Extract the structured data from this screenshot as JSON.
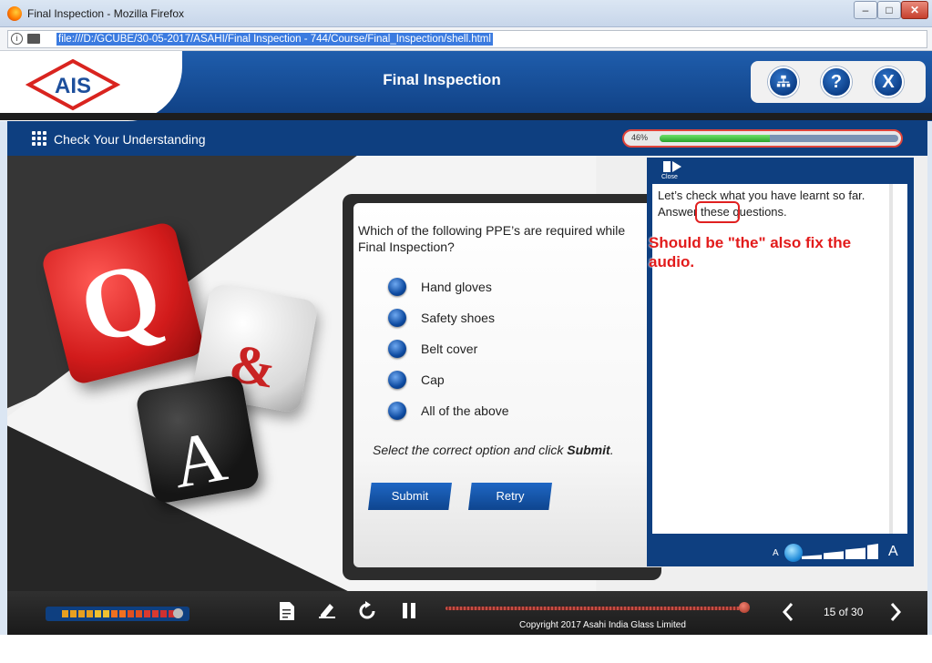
{
  "browser": {
    "window_title": "Final Inspection - Mozilla Firefox",
    "url": "file:///D:/GCUBE/30-05-2017/ASAHI/Final Inspection - 744/Course/Final_Inspection/shell.html",
    "window_buttons": {
      "minimize": "‒",
      "maximize": "□",
      "close": "✕"
    }
  },
  "header": {
    "logo_text": "AIS",
    "course_title": "Final Inspection",
    "buttons": {
      "sitemap": "sitemap-icon",
      "help_label": "?",
      "exit_label": "X"
    }
  },
  "subheader": {
    "section_title": "Check Your Understanding",
    "progress": {
      "percent_label": "46%",
      "value": 0.46
    }
  },
  "question": {
    "text": "Which of the following PPE’s are required while Final Inspection?",
    "options": [
      "Hand gloves",
      "Safety shoes",
      "Belt cover",
      "Cap",
      "All of the above"
    ],
    "instruction_prefix": "Select the correct option and click ",
    "instruction_action": "Submit",
    "instruction_suffix": ".",
    "submit_label": "Submit",
    "retry_label": "Retry"
  },
  "dice": {
    "red": "Q",
    "white": "&",
    "black": "A"
  },
  "transcript": {
    "close_label": "Close",
    "line1": "Let’s check what you have learnt so far.",
    "line2": "Answer these questions.",
    "annotation": "Should be \"the\" also fix the audio.",
    "font_small": "A",
    "font_large": "A",
    "font_level": 0.2
  },
  "footer": {
    "copyright": "Copyright 2017 Asahi India Glass Limited",
    "page_indicator": "15 of 30",
    "seek_value": 1.0,
    "colors": {
      "seek": "#c84d43",
      "volume_on": "#e8a020"
    }
  }
}
